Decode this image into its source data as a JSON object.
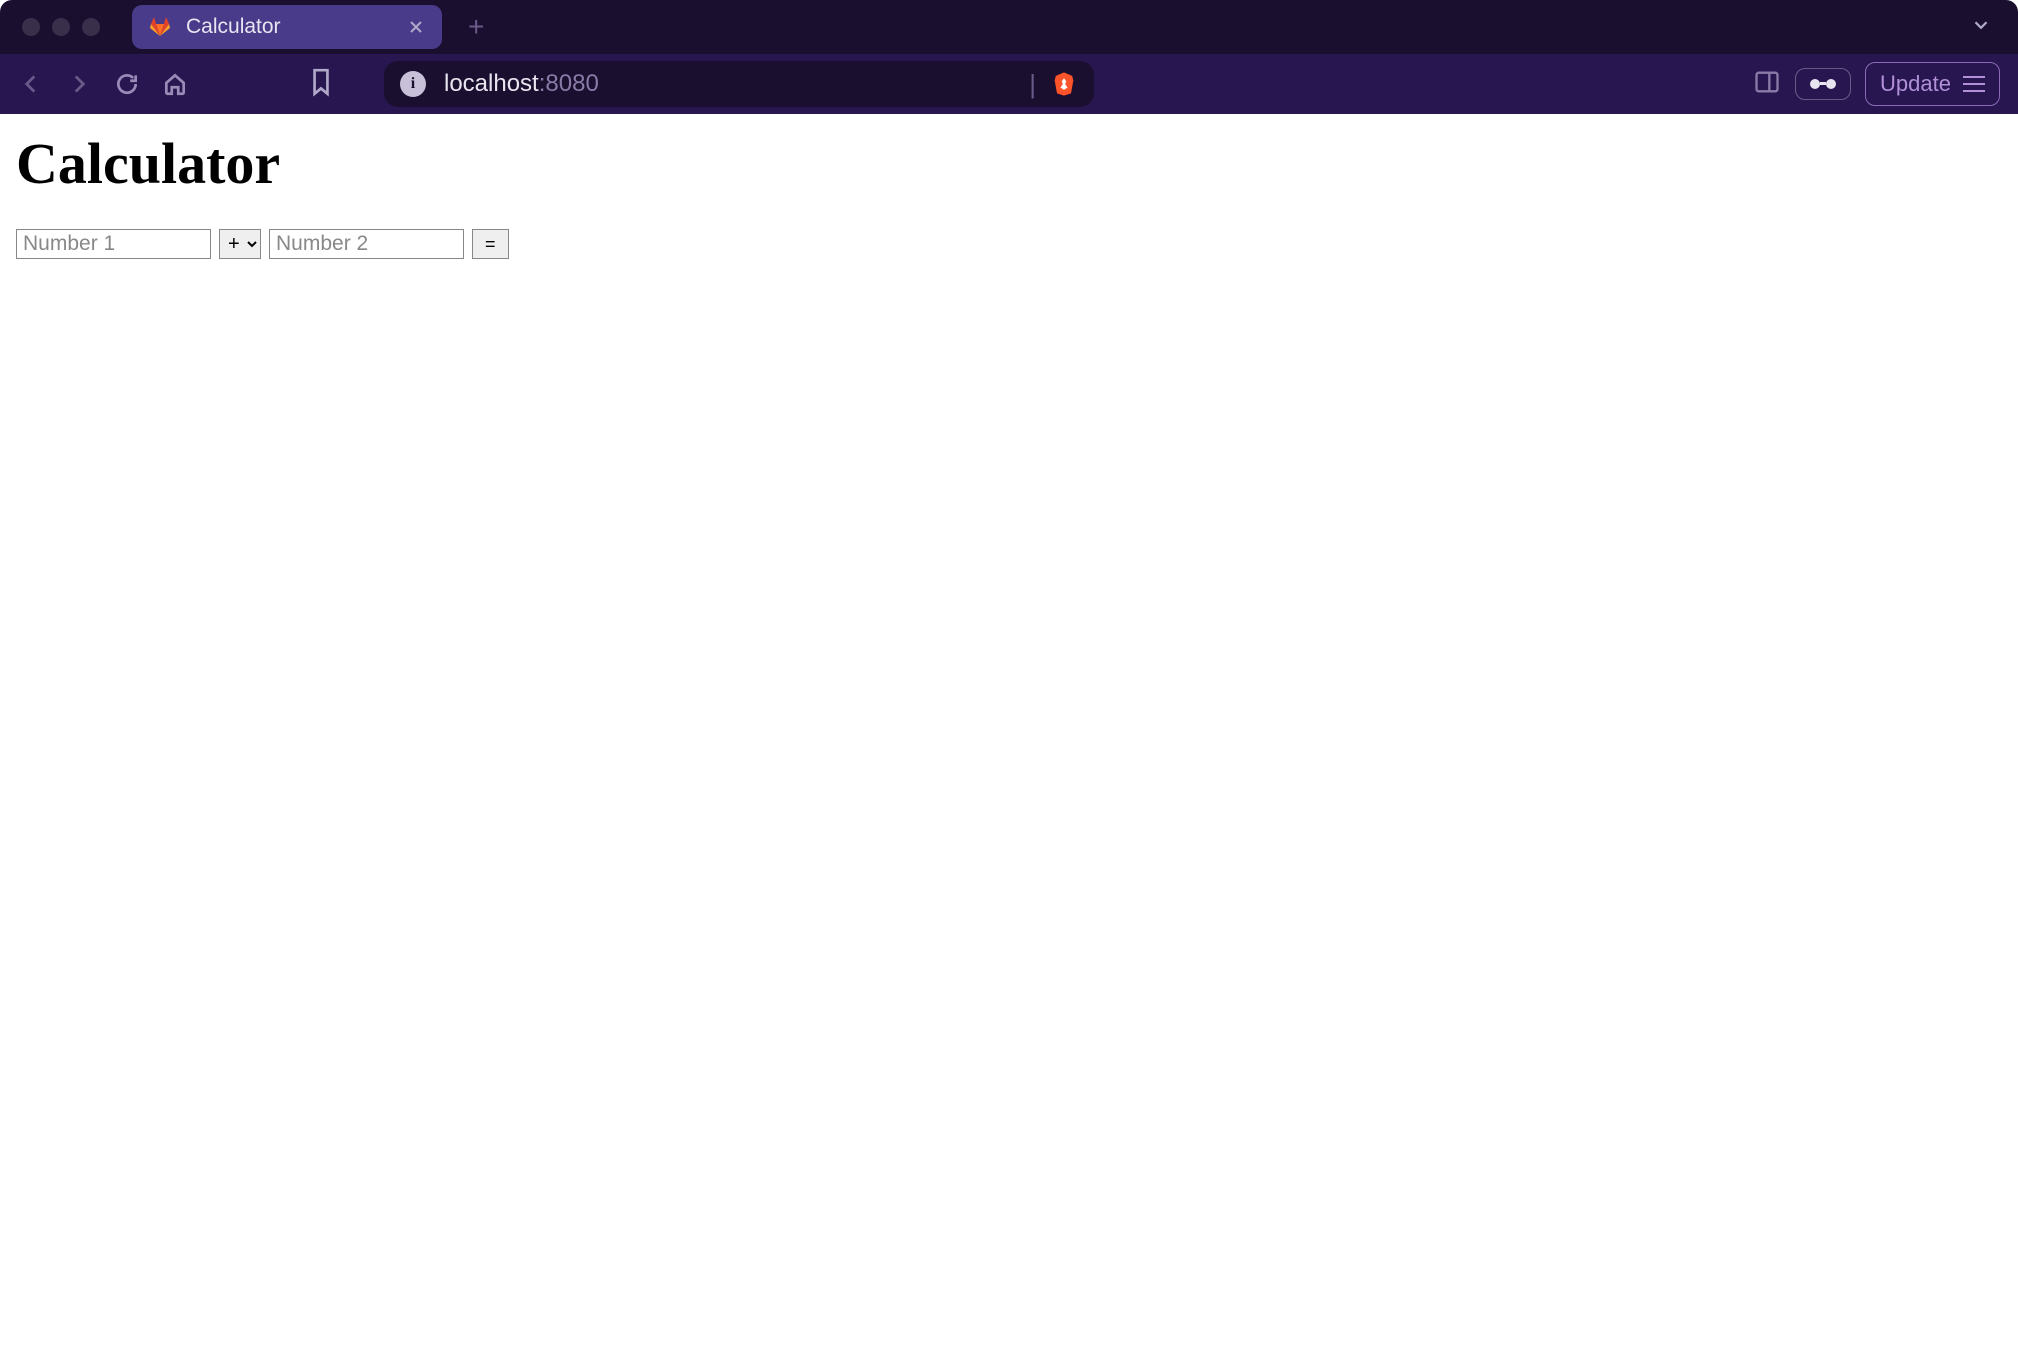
{
  "browser": {
    "tab_title": "Calculator",
    "url_host": "localhost",
    "url_port": ":8080",
    "update_label": "Update"
  },
  "page": {
    "heading": "Calculator",
    "input1_placeholder": "Number 1",
    "input2_placeholder": "Number 2",
    "operator_selected": "+",
    "equals_label": "="
  }
}
